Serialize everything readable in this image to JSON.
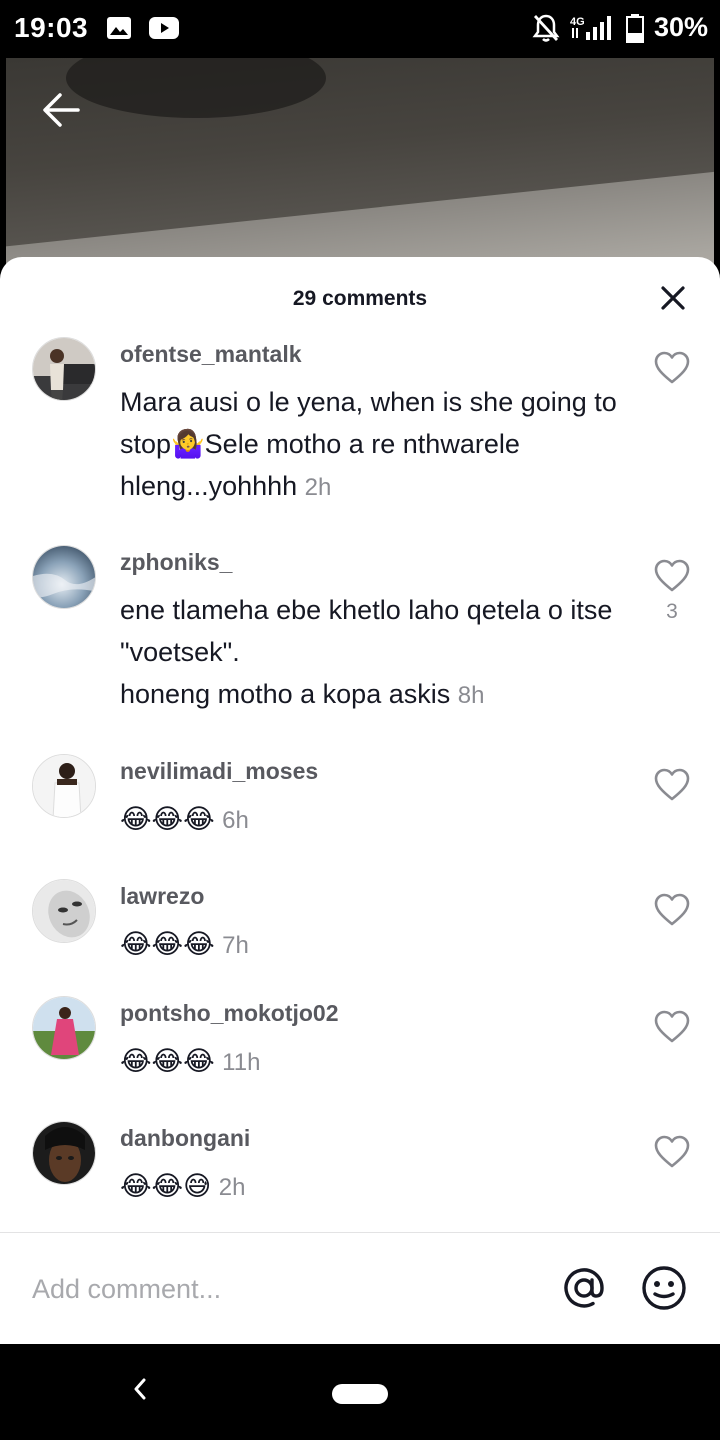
{
  "status_bar": {
    "time": "19:03",
    "network": "4G",
    "battery": "30%",
    "icons": [
      "image-icon",
      "youtube-icon",
      "mute-bell-icon",
      "signal-icon",
      "battery-icon"
    ]
  },
  "comments_sheet": {
    "title": "29 comments",
    "comments": [
      {
        "username": "ofentse_mantalk",
        "text": "Mara ausi o le yena, when is she going to stop",
        "emoji": "🤷‍♀️",
        "text2": "Sele motho a re nthwarele hleng...yohhhh",
        "time": "2h",
        "likes": ""
      },
      {
        "username": "zphoniks_",
        "text": "ene tlameha ebe khetlo laho qetela o itse \"voetsek\".",
        "text2": "honeng motho a kopa askis",
        "time": "8h",
        "likes": "3"
      },
      {
        "username": "nevilimadi_moses",
        "emojis": "😂😂😂",
        "time": "6h",
        "likes": ""
      },
      {
        "username": "lawrezo",
        "emojis": "😂😂😂",
        "time": "7h",
        "likes": ""
      },
      {
        "username": "pontsho_mokotjo02",
        "emojis": "😂😂😂",
        "time": "11h",
        "likes": ""
      },
      {
        "username": "danbongani",
        "emojis": "😂😂😅",
        "time": "2h",
        "likes": ""
      }
    ]
  },
  "input": {
    "placeholder": "Add comment..."
  },
  "colors": {
    "primary_text": "#161823",
    "username": "#58595f",
    "secondary": "#8a8b91"
  }
}
